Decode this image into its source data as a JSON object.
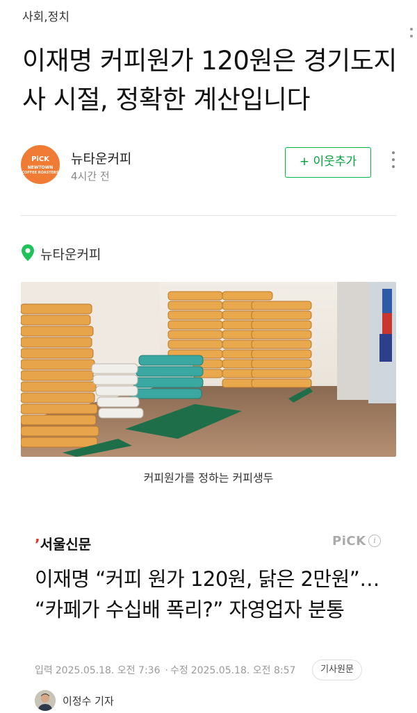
{
  "category": "사회,정치",
  "title": "이재명 커피원가 120원은 경기도지사 시절, 정확한 계산입니다",
  "author": {
    "name": "뉴타운커피",
    "time": "4시간 전",
    "avatar_text": [
      "PiCK",
      "NEWTOWN",
      "COFFEE ROASTERS"
    ],
    "add_button": "+ 이웃추가"
  },
  "place": {
    "label": "뉴타운커피",
    "icon": "location-pin-icon"
  },
  "photo": {
    "caption": "커피원가를 정하는 커피생두"
  },
  "news": {
    "source": "서울신문",
    "pick": "PiCK",
    "pick_info": "i",
    "headline": "이재명 “커피 원가 120원, 닭은 2만원”… “카페가 수십배 폭리?” 자영업자 분통",
    "input_label": "입력",
    "input_date": "2025.05.18. 오전 7:36",
    "separator": "·",
    "edit_label": "수정",
    "edit_date": "2025.05.18. 오전 8:57",
    "original_button": "기사원문",
    "reporter": "이정수 기자"
  },
  "colors": {
    "accent_green": "#00b843",
    "avatar_orange": "#ef7b34",
    "pin_green": "#1ec25a"
  }
}
